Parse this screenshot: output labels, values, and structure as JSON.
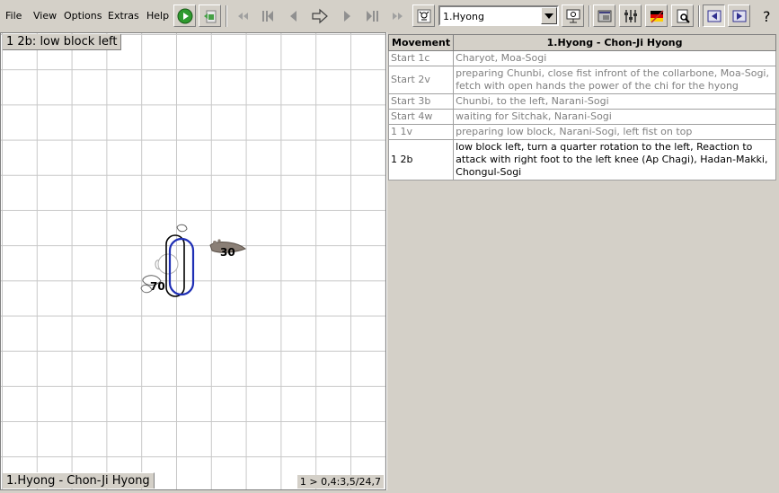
{
  "menu": [
    "File",
    "View",
    "Options",
    "Extras",
    "Help"
  ],
  "form_select": {
    "value": "1.Hyong"
  },
  "icons": {
    "play": "play-icon",
    "export": "export-icon",
    "first": "skip-to-start-icon",
    "prev_many": "step-back-icon",
    "prev": "previous-icon",
    "go": "go-outline-arrow-icon",
    "next": "next-icon",
    "next_many": "step-forward-icon",
    "last": "skip-to-end-icon",
    "figure": "figure-icon",
    "presentation": "presentation-icon",
    "window": "window-icon",
    "settings": "settings-sliders-icon",
    "language": "german-flag-icon",
    "preview": "print-preview-icon",
    "view_left": "view-left-icon",
    "view_right": "view-right-icon",
    "help": "help-icon"
  },
  "colors": {
    "grid": "#c8c8c8",
    "belt": "#1f2fb5",
    "chrome": "#d4d0c8"
  },
  "canvas": {
    "step_label": "1 2b: low block left",
    "form_label": "1.Hyong - Chon-Ji Hyong",
    "coords": "1 > 0,4:3,5/24,7",
    "foot_right_weight": "30",
    "foot_left_weight": "70"
  },
  "table": {
    "headers": [
      "Movement",
      "1.Hyong - Chon-Ji Hyong"
    ],
    "rows": [
      {
        "move": "Start 1c",
        "desc": "Charyot, Moa-Sogi",
        "state": "done"
      },
      {
        "move": "Start 2v",
        "desc": "preparing Chunbi, close fist infront of the collarbone, Moa-Sogi, fetch with open hands the power of the chi for the hyong",
        "state": "done"
      },
      {
        "move": "Start 3b",
        "desc": "Chunbi, to the left, Narani-Sogi",
        "state": "done"
      },
      {
        "move": "Start 4w",
        "desc": "waiting for Sitchak, Narani-Sogi",
        "state": "done"
      },
      {
        "move": "1 1v",
        "desc": "preparing low block, Narani-Sogi, left fist on top",
        "state": "done"
      },
      {
        "move": "1 2b",
        "desc": "low block left, turn a quarter rotation to the left, Reaction to attack with right foot to the left knee (Ap Chagi), Hadan-Makki, Chongul-Sogi",
        "state": "current"
      }
    ]
  }
}
